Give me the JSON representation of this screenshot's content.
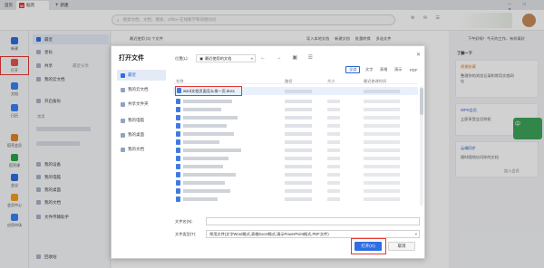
{
  "tabs": [
    {
      "label": "首页"
    },
    {
      "label": "稻壳"
    },
    {
      "label": "新建"
    }
  ],
  "search": {
    "placeholder": "搜索文档、文档、模板、Office 在线教学和快捷访问"
  },
  "rail": [
    {
      "label": "新建",
      "color": "#2f6de1"
    },
    {
      "label": "打开",
      "color": "#e5534b"
    },
    {
      "label": "文档",
      "color": "#3b82f6"
    },
    {
      "label": "日历",
      "color": "#3b82f6"
    },
    {
      "label": "稻壳会员",
      "color": "#e0862a"
    },
    {
      "label": "稻壳课",
      "color": "#28a745"
    },
    {
      "label": "会议",
      "color": "#2f6de1"
    },
    {
      "label": "会员中心",
      "color": "#f0a020"
    },
    {
      "label": "应用市场",
      "color": "#3b82f6"
    }
  ],
  "nav": {
    "items": [
      "最近",
      "星标",
      "共享",
      "我的云文档",
      "开启备份"
    ],
    "share_extra": "最近分享",
    "section_label": "常用",
    "more_items": [
      "我的设备",
      "我的电脑",
      "我的桌面",
      "我的文档",
      "文件传输助手"
    ],
    "trash": "回收站"
  },
  "main": {
    "header_left": "最近使用 (3) 个文件",
    "header_right": [
      "导入本地文档",
      "新建文档",
      "批量转换",
      "多选文件"
    ]
  },
  "right": {
    "banner": "下午好呀！今天的工作，有你真好",
    "section": "了解一下",
    "cards": [
      {
        "title": "便捷收藏",
        "body": "整理你的浏览记录和常用文档网址"
      },
      {
        "title": "WPS会员",
        "body": "立即享受会员特权"
      },
      {
        "title": "云端同步",
        "body": "随时随地访问你的文档"
      }
    ],
    "sticker_text": "中",
    "footer": "加入会员"
  },
  "dialog": {
    "title": "打开文件",
    "side": [
      "最近",
      "我的云文档",
      "共享文件夹",
      "我的电脑",
      "我的桌面",
      "我的文档"
    ],
    "location_label": "位置(L):",
    "location_value": "最近使用的文档",
    "filters": [
      "全部",
      "文字",
      "表格",
      "演示",
      "PDF"
    ],
    "columns": {
      "name": "名称",
      "path": "路径",
      "size": "大小",
      "modified": "最近修改时间"
    },
    "selected_file": "word文档页面怎么排一页.docx",
    "filename_label": "文件名(N):",
    "filename_value": "",
    "filetype_label": "文件类型(T):",
    "filetype_value": "常用文件(文字Word格式,表格Excel格式,演示PowerPoint格式,PDF文件)",
    "open_button": "打开(O)",
    "cancel_button": "取消"
  }
}
